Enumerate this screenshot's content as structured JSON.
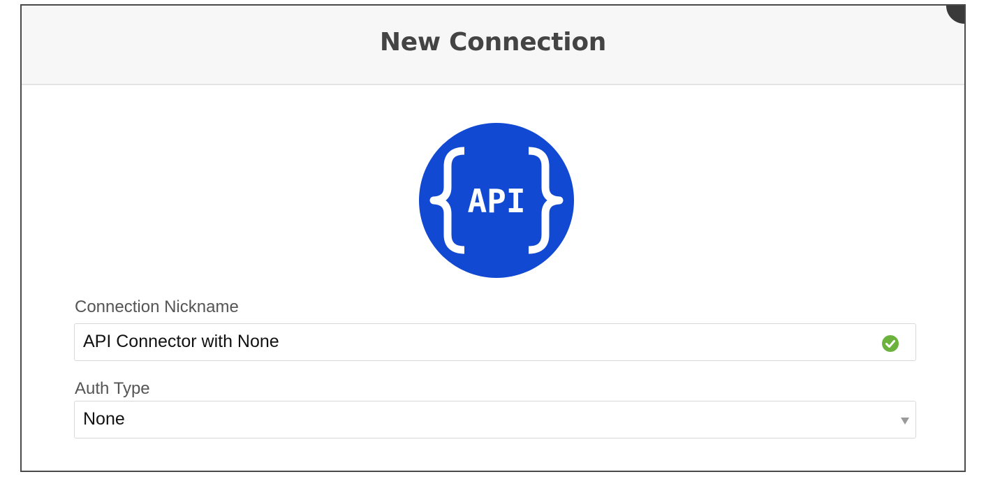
{
  "modal": {
    "title": "New Connection"
  },
  "logo": {
    "text": "API",
    "color": "#1249d3",
    "icon": "api-logo-icon"
  },
  "form": {
    "nickname": {
      "label": "Connection Nickname",
      "value": "API Connector with None",
      "status_icon": "check-circle-icon",
      "status_color": "#6cb33e"
    },
    "auth_type": {
      "label": "Auth Type",
      "selected": "None",
      "icon": "caret-down-icon"
    }
  }
}
